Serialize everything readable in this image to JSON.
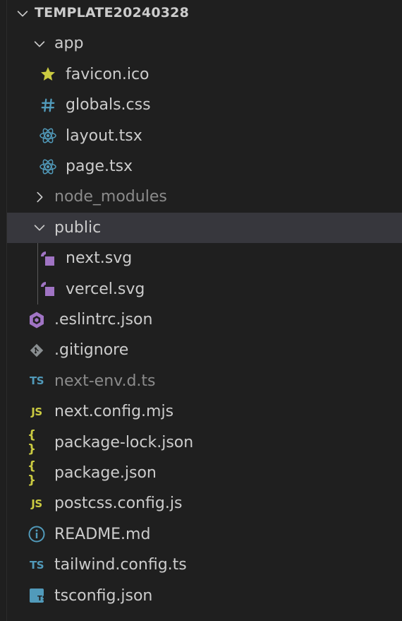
{
  "explorer": {
    "root": {
      "label": "TEMPLATE20240328",
      "expanded": true
    },
    "items": [
      {
        "label": "app",
        "kind": "folder",
        "expanded": true,
        "depth": 1
      },
      {
        "label": "favicon.ico",
        "kind": "file",
        "icon": "star-icon",
        "icon_color": "#cbcb41",
        "depth": 2
      },
      {
        "label": "globals.css",
        "kind": "file",
        "icon": "hash-icon",
        "icon_color": "#519aba",
        "depth": 2
      },
      {
        "label": "layout.tsx",
        "kind": "file",
        "icon": "react-icon",
        "icon_color": "#519aba",
        "depth": 2
      },
      {
        "label": "page.tsx",
        "kind": "file",
        "icon": "react-icon",
        "icon_color": "#519aba",
        "depth": 2
      },
      {
        "label": "node_modules",
        "kind": "folder",
        "expanded": false,
        "dimmed": true,
        "depth": 1
      },
      {
        "label": "public",
        "kind": "folder",
        "expanded": true,
        "selected": true,
        "depth": 1
      },
      {
        "label": "next.svg",
        "kind": "file",
        "icon": "svg-icon",
        "icon_color": "#a074c4",
        "depth": 2
      },
      {
        "label": "vercel.svg",
        "kind": "file",
        "icon": "svg-icon",
        "icon_color": "#a074c4",
        "depth": 2
      },
      {
        "label": ".eslintrc.json",
        "kind": "file",
        "icon": "eslint-icon",
        "icon_color": "#a074c4",
        "depth": 1
      },
      {
        "label": ".gitignore",
        "kind": "file",
        "icon": "git-icon",
        "icon_color": "#41535b",
        "depth": 1
      },
      {
        "label": "next-env.d.ts",
        "kind": "file",
        "icon": "ts-icon",
        "icon_text": "TS",
        "icon_color": "#519aba",
        "dimmed": true,
        "depth": 1
      },
      {
        "label": "next.config.mjs",
        "kind": "file",
        "icon": "js-icon",
        "icon_text": "JS",
        "icon_color": "#cbcb41",
        "depth": 1
      },
      {
        "label": "package-lock.json",
        "kind": "file",
        "icon": "json-icon",
        "icon_text": "{ }",
        "icon_color": "#cbcb41",
        "depth": 1
      },
      {
        "label": "package.json",
        "kind": "file",
        "icon": "json-icon",
        "icon_text": "{ }",
        "icon_color": "#cbcb41",
        "depth": 1
      },
      {
        "label": "postcss.config.js",
        "kind": "file",
        "icon": "js-icon",
        "icon_text": "JS",
        "icon_color": "#cbcb41",
        "depth": 1
      },
      {
        "label": "README.md",
        "kind": "file",
        "icon": "info-icon",
        "icon_color": "#519aba",
        "depth": 1
      },
      {
        "label": "tailwind.config.ts",
        "kind": "file",
        "icon": "ts-icon",
        "icon_text": "TS",
        "icon_color": "#519aba",
        "depth": 1
      },
      {
        "label": "tsconfig.json",
        "kind": "file",
        "icon": "tsconfig-icon",
        "icon_text": "TS",
        "icon_color": "#519aba",
        "depth": 1
      }
    ]
  },
  "colors": {
    "background": "#1f1f1f",
    "selected_row": "#37373d",
    "text": "#cccccc",
    "dim_text": "#8b8b8b",
    "indent_guide": "#585858"
  }
}
